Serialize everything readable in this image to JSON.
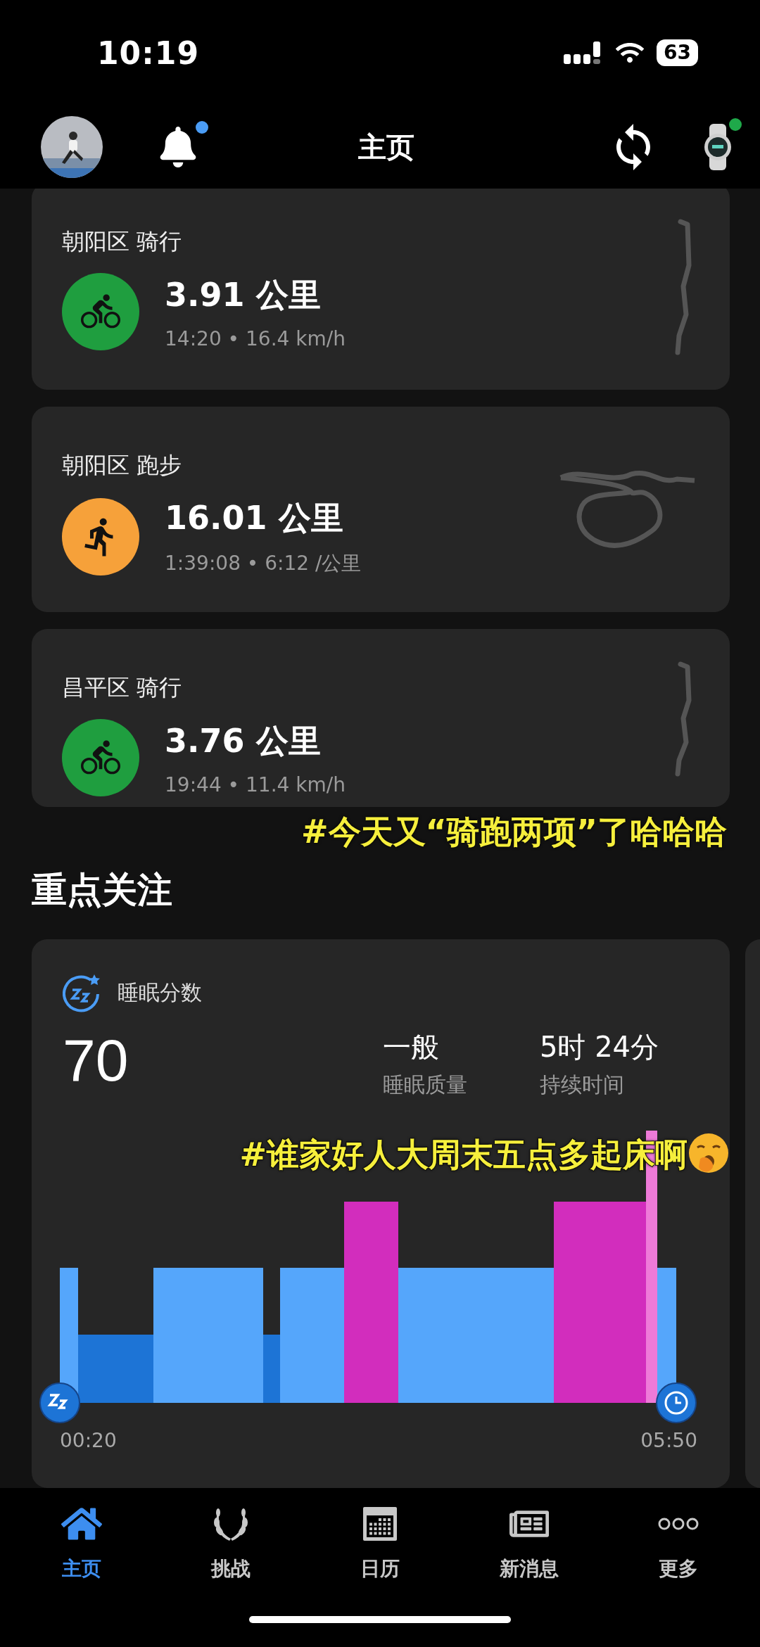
{
  "status_bar": {
    "time": "10:19",
    "battery": "63"
  },
  "header": {
    "title": "主页",
    "has_unread": true,
    "device_connected": true
  },
  "activities": [
    {
      "kind": "cycling",
      "title": "朝阳区 骑行",
      "distance": "3.91 公里",
      "details": "14:20 • 16.4 km/h"
    },
    {
      "kind": "running",
      "title": "朝阳区 跑步",
      "distance": "16.01 公里",
      "details": "1:39:08 • 6:12 /公里"
    },
    {
      "kind": "cycling",
      "title": "昌平区 骑行",
      "distance": "3.76 公里",
      "details": "19:44 • 11.4 km/h"
    }
  ],
  "annotations": [
    "#今天又“骑跑两项”了哈哈哈",
    "#谁家好人大周末五点多起床啊"
  ],
  "focus": {
    "heading": "重点关注"
  },
  "sleep_card": {
    "title": "睡眠分数",
    "score": "70",
    "quality": "一般",
    "quality_label": "睡眠质量",
    "duration": "5时 24分",
    "duration_label": "持续时间",
    "start_time": "00:20",
    "end_time": "05:50"
  },
  "tabs": [
    {
      "label": "主页",
      "selected": true
    },
    {
      "label": "挑战",
      "selected": false
    },
    {
      "label": "日历",
      "selected": false
    },
    {
      "label": "新消息",
      "selected": false
    },
    {
      "label": "更多",
      "selected": false
    }
  ]
}
